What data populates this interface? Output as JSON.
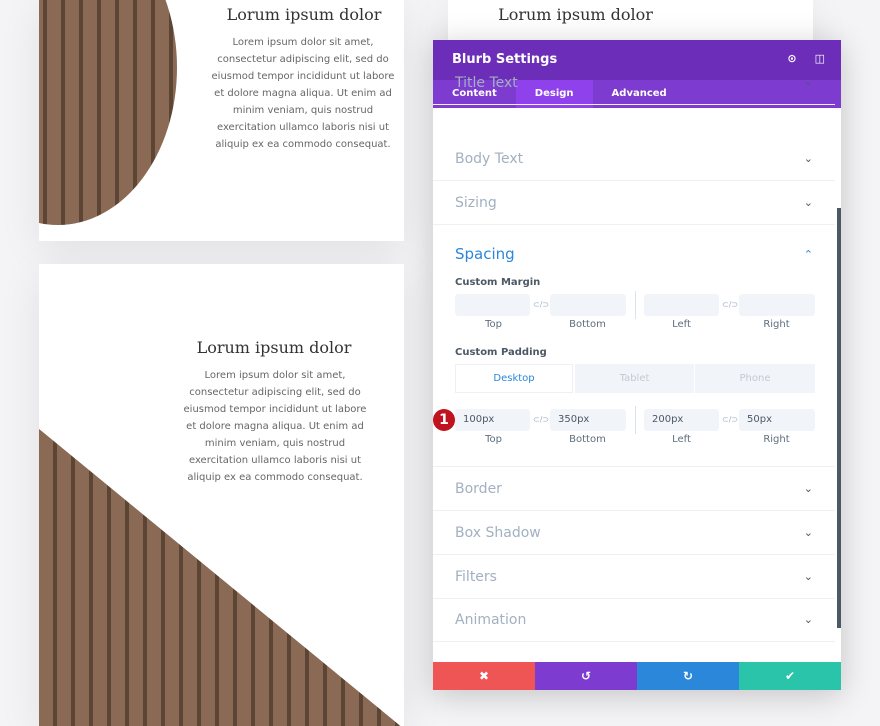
{
  "cards": [
    {
      "title": "Lorum ipsum dolor",
      "text": "Lorem ipsum dolor sit amet, consectetur adipiscing elit, sed do eiusmod tempor incididunt ut labore et dolore magna aliqua. Ut enim ad minim veniam, quis nostrud exercitation ullamco laboris nisi ut aliquip ex ea commodo consequat."
    },
    {
      "title": "Lorum ipsum dolor",
      "text": "Lorem ipsum dolor sit amet, consectetur adipiscing elit, sed do eiusmod tempor incididunt ut labore et dolore magna aliqua. Ut enim ad minim veniam, quis nostrud exercitation ullamco laboris nisi ut aliquip ex ea commodo consequat."
    },
    {
      "title": "Lorum ipsum dolor"
    }
  ],
  "panel": {
    "title": "Blurb Settings",
    "tabs": [
      "Content",
      "Design",
      "Advanced"
    ],
    "sections": [
      "Title Text",
      "Body Text",
      "Sizing",
      "Spacing",
      "Border",
      "Box Shadow",
      "Filters",
      "Animation"
    ],
    "margin_label": "Custom Margin",
    "padding_label": "Custom Padding",
    "sides": [
      "Top",
      "Bottom",
      "Left",
      "Right"
    ],
    "devices": [
      "Desktop",
      "Tablet",
      "Phone"
    ],
    "padding_values": [
      "100px",
      "350px",
      "200px",
      "50px"
    ],
    "link_glyph": "⊂/⊃",
    "badge": "1"
  },
  "footer": {
    "cancel": "✖",
    "undo": "↺",
    "redo": "↻",
    "save": "✔"
  },
  "colors": {
    "header": "#6c2eb9",
    "tabs": "#7e3bd0",
    "accent": "#2b87da",
    "cancel": "#ef5555",
    "undo": "#7e3bd0",
    "redo": "#2b87da",
    "save": "#29c4a9"
  }
}
